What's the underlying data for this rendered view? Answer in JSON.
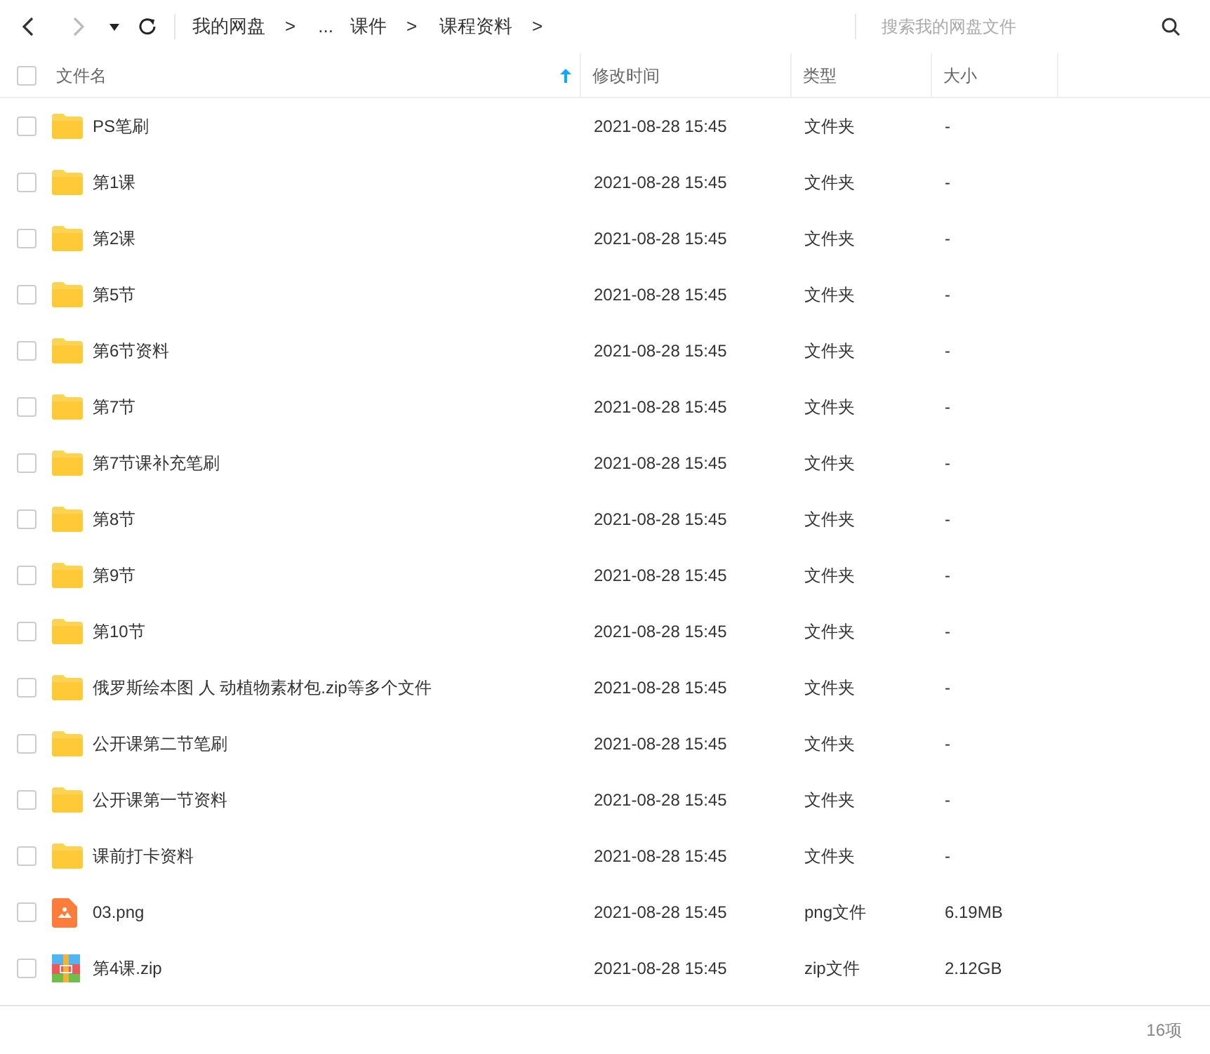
{
  "toolbar": {
    "breadcrumbs": [
      {
        "label": "我的网盘",
        "separator": ">"
      },
      {
        "label": "..."
      },
      {
        "label": "课件",
        "separator": ">"
      },
      {
        "label": "课程资料",
        "separator": ">"
      }
    ],
    "search": {
      "placeholder": "搜索我的网盘文件"
    }
  },
  "table": {
    "select_all": {
      "checked": false
    },
    "columns": [
      {
        "label": "文件名",
        "sorted": true
      },
      {
        "label": "修改时间",
        "sorted": false
      },
      {
        "label": "类型",
        "sorted": false
      },
      {
        "label": "大小",
        "sorted": false
      }
    ],
    "rows": [
      {
        "kind": "folder",
        "checked": false,
        "name": "PS笔刷",
        "modified": "2021-08-28 15:45",
        "type": "文件夹",
        "size": "-"
      },
      {
        "kind": "folder",
        "checked": false,
        "name": "第1课",
        "modified": "2021-08-28 15:45",
        "type": "文件夹",
        "size": "-"
      },
      {
        "kind": "folder",
        "checked": false,
        "name": "第2课",
        "modified": "2021-08-28 15:45",
        "type": "文件夹",
        "size": "-"
      },
      {
        "kind": "folder",
        "checked": false,
        "name": "第5节",
        "modified": "2021-08-28 15:45",
        "type": "文件夹",
        "size": "-"
      },
      {
        "kind": "folder",
        "checked": false,
        "name": "第6节资料",
        "modified": "2021-08-28 15:45",
        "type": "文件夹",
        "size": "-"
      },
      {
        "kind": "folder",
        "checked": false,
        "name": "第7节",
        "modified": "2021-08-28 15:45",
        "type": "文件夹",
        "size": "-"
      },
      {
        "kind": "folder",
        "checked": false,
        "name": "第7节课补充笔刷",
        "modified": "2021-08-28 15:45",
        "type": "文件夹",
        "size": "-"
      },
      {
        "kind": "folder",
        "checked": false,
        "name": "第8节",
        "modified": "2021-08-28 15:45",
        "type": "文件夹",
        "size": "-"
      },
      {
        "kind": "folder",
        "checked": false,
        "name": "第9节",
        "modified": "2021-08-28 15:45",
        "type": "文件夹",
        "size": "-"
      },
      {
        "kind": "folder",
        "checked": false,
        "name": "第10节",
        "modified": "2021-08-28 15:45",
        "type": "文件夹",
        "size": "-"
      },
      {
        "kind": "folder",
        "checked": false,
        "name": "俄罗斯绘本图 人 动植物素材包.zip等多个文件",
        "modified": "2021-08-28 15:45",
        "type": "文件夹",
        "size": "-"
      },
      {
        "kind": "folder",
        "checked": false,
        "name": "公开课第二节笔刷",
        "modified": "2021-08-28 15:45",
        "type": "文件夹",
        "size": "-"
      },
      {
        "kind": "folder",
        "checked": false,
        "name": "公开课第一节资料",
        "modified": "2021-08-28 15:45",
        "type": "文件夹",
        "size": "-"
      },
      {
        "kind": "folder",
        "checked": false,
        "name": "课前打卡资料",
        "modified": "2021-08-28 15:45",
        "type": "文件夹",
        "size": "-"
      },
      {
        "kind": "image",
        "checked": false,
        "name": "03.png",
        "modified": "2021-08-28 15:45",
        "type": "png文件",
        "size": "6.19MB"
      },
      {
        "kind": "zip",
        "checked": false,
        "name": "第4课.zip",
        "modified": "2021-08-28 15:45",
        "type": "zip文件",
        "size": "2.12GB"
      }
    ]
  },
  "status_bar": {
    "count": "16项"
  }
}
